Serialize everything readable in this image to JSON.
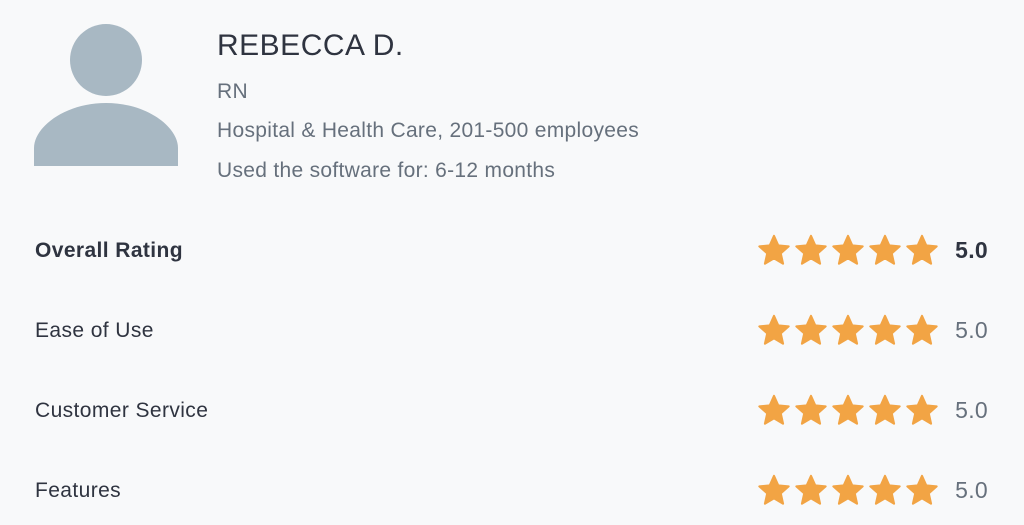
{
  "reviewer": {
    "avatar_icon": "user-silhouette-icon",
    "name": "REBECCA D.",
    "title": "RN",
    "industry": "Hospital & Health Care, 201-500 employees",
    "usage": "Used the software for: 6-12 months"
  },
  "ratings": [
    {
      "label": "Overall Rating",
      "stars": 5,
      "score": "5.0"
    },
    {
      "label": "Ease of Use",
      "stars": 5,
      "score": "5.0"
    },
    {
      "label": "Customer Service",
      "stars": 5,
      "score": "5.0"
    },
    {
      "label": "Features",
      "stars": 5,
      "score": "5.0"
    }
  ],
  "colors": {
    "star": "#f2a444",
    "avatar": "#a8b8c3",
    "background": "#f8f9fa",
    "text": "#2f3440",
    "muted": "#66707c"
  }
}
